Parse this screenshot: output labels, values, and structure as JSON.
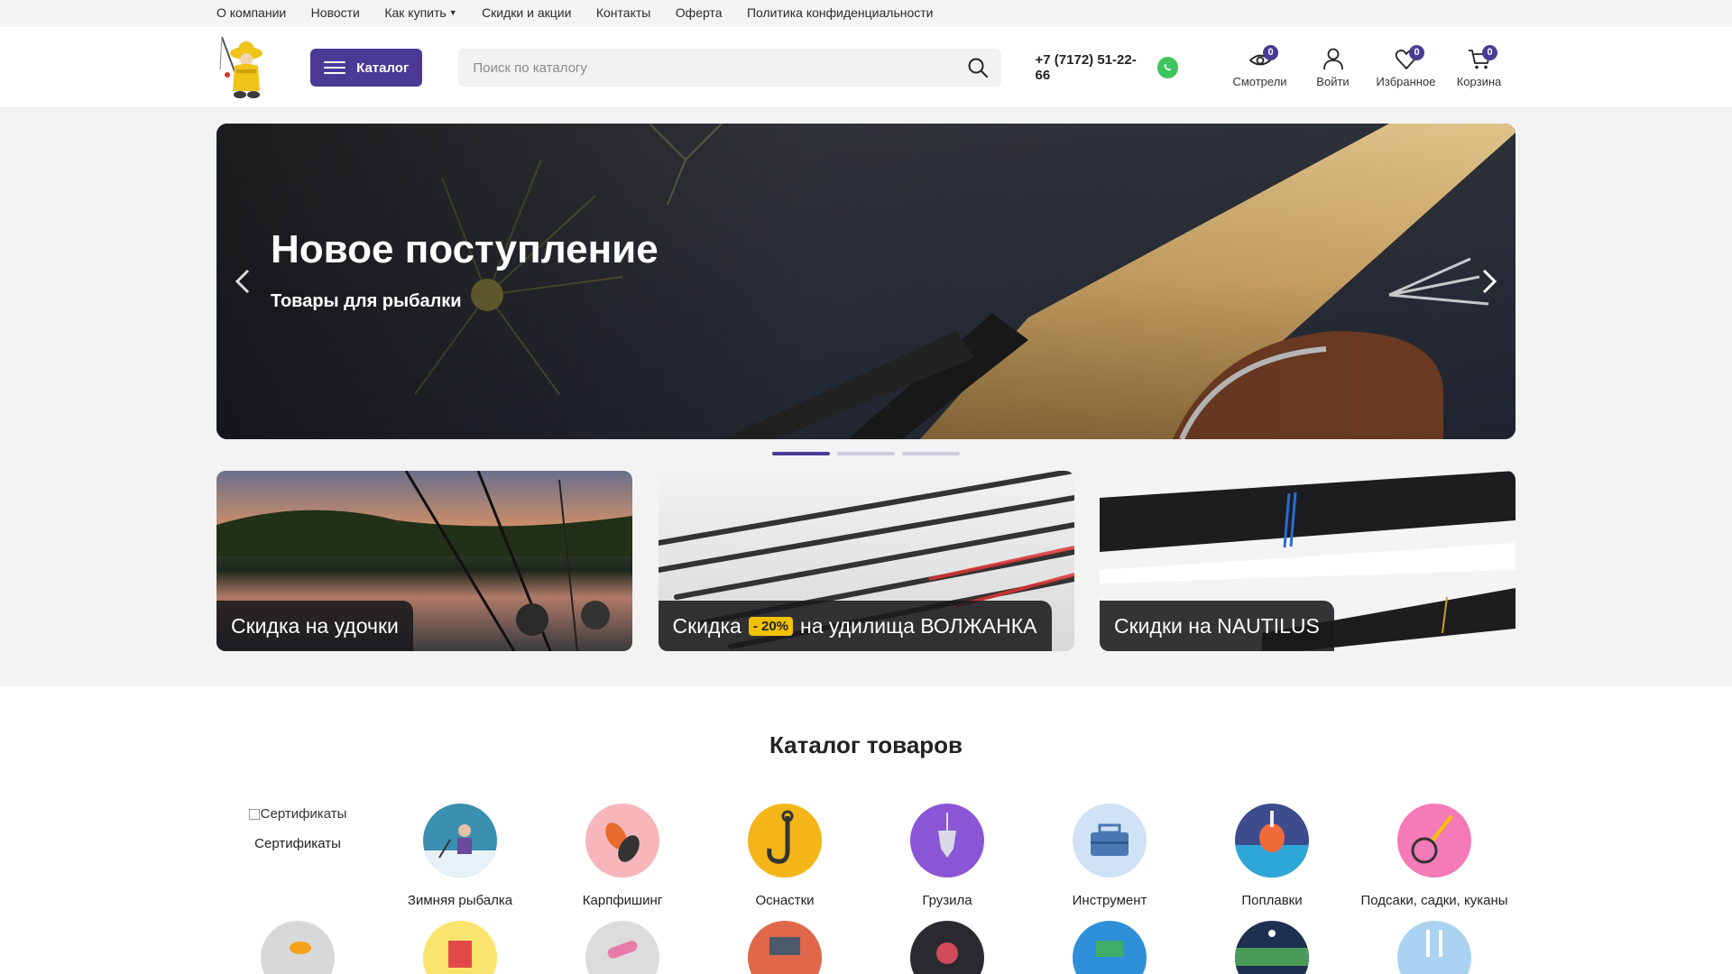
{
  "topnav": {
    "items": [
      {
        "label": "О компании"
      },
      {
        "label": "Новости"
      },
      {
        "label": "Как купить"
      },
      {
        "label": "Скидки и акции"
      },
      {
        "label": "Контакты"
      },
      {
        "label": "Оферта"
      },
      {
        "label": "Политика конфиденциальности"
      }
    ]
  },
  "header": {
    "catalog_label": "Каталог",
    "search_placeholder": "Поиск по каталогу",
    "phone": "+7 (7172) 51-22-66",
    "icons": [
      {
        "label": "Смотрели",
        "count": "0",
        "icon": "eye-icon"
      },
      {
        "label": "Войти",
        "icon": "user-icon"
      },
      {
        "label": "Избранное",
        "count": "0",
        "icon": "heart-icon"
      },
      {
        "label": "Корзина",
        "count": "0",
        "icon": "cart-icon"
      }
    ]
  },
  "hero": {
    "title": "Новое поступление",
    "subtitle": "Товары для рыбалки"
  },
  "banners": [
    {
      "text": "Скидка на удочки"
    },
    {
      "text_before": "Скидка",
      "tag": "- 20%",
      "text_after": "на удилища ВОЛЖАНКА"
    },
    {
      "text": "Скидки на NAUTILUS"
    }
  ],
  "catalog": {
    "title": "Каталог товаров",
    "row1": [
      {
        "name": "Сертификаты",
        "alt": "Сертификаты"
      },
      {
        "name": "Зимняя рыбалка"
      },
      {
        "name": "Карпфишинг"
      },
      {
        "name": "Оснастки"
      },
      {
        "name": "Грузила"
      },
      {
        "name": "Инструмент"
      },
      {
        "name": "Поплавки"
      },
      {
        "name": "Подсаки, садки, куканы"
      }
    ]
  },
  "colors": {
    "accent": "#4a3a96",
    "whatsapp": "#3fc35c",
    "sale_tag": "#f2c200"
  }
}
